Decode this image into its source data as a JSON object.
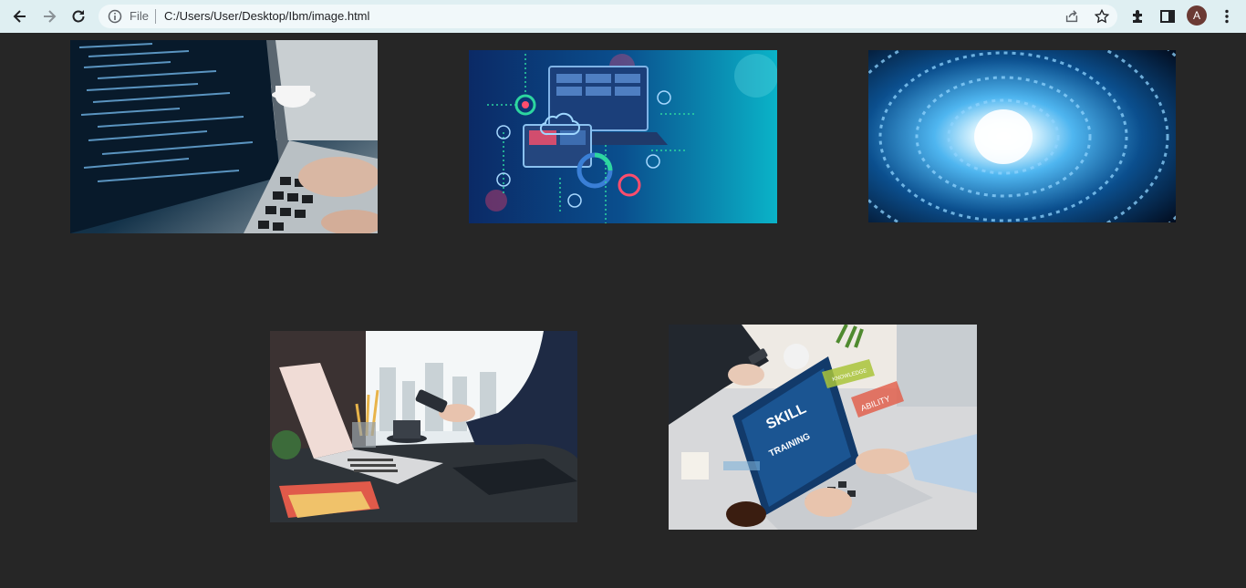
{
  "browser": {
    "url_scheme": "File",
    "url": "C:/Users/User/Desktop/Ibm/image.html",
    "profile_initial": "A",
    "icons": [
      "back-arrow-icon",
      "forward-arrow-icon",
      "reload-icon",
      "info-icon",
      "share-icon",
      "star-icon",
      "extensions-icon",
      "side-panel-icon",
      "kebab-menu-icon"
    ]
  },
  "page": {
    "background": "#262626",
    "images": [
      {
        "subject": "laptop-coding-photo"
      },
      {
        "subject": "digital-devices-illustration"
      },
      {
        "subject": "binary-tunnel-photo"
      },
      {
        "subject": "laptop-desk-phone-photo"
      },
      {
        "subject": "skill-training-laptop-photo",
        "overlay_texts": [
          "SKILL",
          "TRAINING",
          "KNOWLEDGE",
          "ABILITY"
        ]
      }
    ]
  }
}
